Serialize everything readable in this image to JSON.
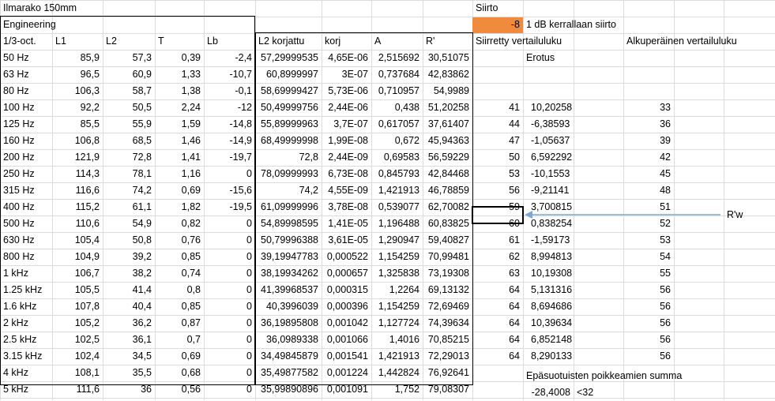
{
  "app": "Spreadsheet",
  "title_cell": "Ilmarako 150mm",
  "engineering_label": "Engineering",
  "headers": [
    "1/3-oct.",
    "L1",
    "L2",
    "T",
    "Lb",
    "L2 korjattu",
    "korj",
    "A",
    "R'"
  ],
  "right_headers": {
    "siirto_label": "Siirto",
    "siirto_value": "-8",
    "siirto_note": "1 dB kerrallaan siirto",
    "shifted_ref": "Siirretty vertailuluku",
    "original_ref": "Alkuperäinen vertailuluku",
    "difference": "Erotus",
    "rw_label": "R'w",
    "sum_label": "Epäsuotuisten poikkeamien summa",
    "sum_value": "-28,4008",
    "sum_limit": "<32"
  },
  "rows": [
    {
      "f": "50 Hz",
      "l1": "85,9",
      "l2": "57,3",
      "t": "0,39",
      "lb": "-2,4",
      "l2k": "57,29999535",
      "korj": "4,65E-06",
      "a": "2,515692",
      "r": "30,51075",
      "s": "",
      "e": "",
      "o": ""
    },
    {
      "f": "63 Hz",
      "l1": "96,5",
      "l2": "60,9",
      "t": "1,33",
      "lb": "-10,7",
      "l2k": "60,8999997",
      "korj": "3E-07",
      "a": "0,737684",
      "r": "42,83862",
      "s": "",
      "e": "",
      "o": ""
    },
    {
      "f": "80 Hz",
      "l1": "106,3",
      "l2": "58,7",
      "t": "1,38",
      "lb": "-0,1",
      "l2k": "58,69999427",
      "korj": "5,73E-06",
      "a": "0,710957",
      "r": "54,9989",
      "s": "",
      "e": "",
      "o": ""
    },
    {
      "f": "100 Hz",
      "l1": "92,2",
      "l2": "50,5",
      "t": "2,24",
      "lb": "-12",
      "l2k": "50,49999756",
      "korj": "2,44E-06",
      "a": "0,438",
      "r": "51,20258",
      "s": "41",
      "e": "10,20258",
      "o": "33"
    },
    {
      "f": "125 Hz",
      "l1": "85,5",
      "l2": "55,9",
      "t": "1,59",
      "lb": "-14,8",
      "l2k": "55,89999963",
      "korj": "3,7E-07",
      "a": "0,617057",
      "r": "37,61407",
      "s": "44",
      "e": "-6,38593",
      "o": "36"
    },
    {
      "f": "160 Hz",
      "l1": "106,8",
      "l2": "68,5",
      "t": "1,46",
      "lb": "-14,9",
      "l2k": "68,49999998",
      "korj": "1,99E-08",
      "a": "0,672",
      "r": "45,94363",
      "s": "47",
      "e": "-1,05637",
      "o": "39"
    },
    {
      "f": "200 Hz",
      "l1": "121,9",
      "l2": "72,8",
      "t": "1,41",
      "lb": "-19,7",
      "l2k": "72,8",
      "korj": "2,44E-09",
      "a": "0,69583",
      "r": "56,59229",
      "s": "50",
      "e": "6,592292",
      "o": "42"
    },
    {
      "f": "250 Hz",
      "l1": "114,3",
      "l2": "78,1",
      "t": "1,16",
      "lb": "0",
      "l2k": "78,09999993",
      "korj": "6,73E-08",
      "a": "0,845793",
      "r": "42,84468",
      "s": "53",
      "e": "-10,1553",
      "o": "45"
    },
    {
      "f": "315 Hz",
      "l1": "116,6",
      "l2": "74,2",
      "t": "0,69",
      "lb": "-15,6",
      "l2k": "74,2",
      "korj": "4,55E-09",
      "a": "1,421913",
      "r": "46,78859",
      "s": "56",
      "e": "-9,21141",
      "o": "48"
    },
    {
      "f": "400 Hz",
      "l1": "115,2",
      "l2": "61,1",
      "t": "1,82",
      "lb": "-19,5",
      "l2k": "61,09999996",
      "korj": "3,78E-08",
      "a": "0,539077",
      "r": "62,70082",
      "s": "59",
      "e": "3,700815",
      "o": "51"
    },
    {
      "f": "500 Hz",
      "l1": "110,6",
      "l2": "54,9",
      "t": "0,82",
      "lb": "0",
      "l2k": "54,89998595",
      "korj": "1,41E-05",
      "a": "1,196488",
      "r": "60,83825",
      "s": "60",
      "e": "0,838254",
      "o": "52"
    },
    {
      "f": "630 Hz",
      "l1": "105,4",
      "l2": "50,8",
      "t": "0,76",
      "lb": "0",
      "l2k": "50,79996388",
      "korj": "3,61E-05",
      "a": "1,290947",
      "r": "59,40827",
      "s": "61",
      "e": "-1,59173",
      "o": "53"
    },
    {
      "f": "800 Hz",
      "l1": "104,9",
      "l2": "39,2",
      "t": "0,85",
      "lb": "0",
      "l2k": "39,19947783",
      "korj": "0,000522",
      "a": "1,154259",
      "r": "70,99481",
      "s": "62",
      "e": "8,994813",
      "o": "54"
    },
    {
      "f": "1 kHz",
      "l1": "106,7",
      "l2": "38,2",
      "t": "0,74",
      "lb": "0",
      "l2k": "38,19934262",
      "korj": "0,000657",
      "a": "1,325838",
      "r": "73,19308",
      "s": "63",
      "e": "10,19308",
      "o": "55"
    },
    {
      "f": "1.25 kHz",
      "l1": "105,5",
      "l2": "41,4",
      "t": "0,8",
      "lb": "0",
      "l2k": "41,39968537",
      "korj": "0,000315",
      "a": "1,2264",
      "r": "69,13132",
      "s": "64",
      "e": "5,131316",
      "o": "56"
    },
    {
      "f": "1.6 kHz",
      "l1": "107,8",
      "l2": "40,4",
      "t": "0,85",
      "lb": "0",
      "l2k": "40,3996039",
      "korj": "0,000396",
      "a": "1,154259",
      "r": "72,69469",
      "s": "64",
      "e": "8,694686",
      "o": "56"
    },
    {
      "f": "2 kHz",
      "l1": "105,2",
      "l2": "36,2",
      "t": "0,87",
      "lb": "0",
      "l2k": "36,19895808",
      "korj": "0,001042",
      "a": "1,127724",
      "r": "74,39634",
      "s": "64",
      "e": "10,39634",
      "o": "56"
    },
    {
      "f": "2.5 kHz",
      "l1": "102,5",
      "l2": "36,1",
      "t": "0,7",
      "lb": "0",
      "l2k": "36,0989338",
      "korj": "0,001066",
      "a": "1,4016",
      "r": "70,85215",
      "s": "64",
      "e": "6,852148",
      "o": "56"
    },
    {
      "f": "3.15 kHz",
      "l1": "102,4",
      "l2": "34,5",
      "t": "0,69",
      "lb": "0",
      "l2k": "34,49845879",
      "korj": "0,001541",
      "a": "1,421913",
      "r": "72,29013",
      "s": "64",
      "e": "8,290133",
      "o": "56"
    },
    {
      "f": "4 kHz",
      "l1": "108,1",
      "l2": "35,5",
      "t": "0,68",
      "lb": "0",
      "l2k": "35,49877582",
      "korj": "0,001224",
      "a": "1,442824",
      "r": "76,92641",
      "s": "",
      "e": "",
      "o": ""
    },
    {
      "f": "5 kHz",
      "l1": "111,6",
      "l2": "36",
      "t": "0,56",
      "lb": "0",
      "l2k": "35,99890896",
      "korj": "0,001091",
      "a": "1,752",
      "r": "79,08307",
      "s": "",
      "e": "",
      "o": ""
    }
  ],
  "colors": {
    "grid": "#dadcdf",
    "accent": "#f08a3c",
    "arrow": "#7fa7cf"
  }
}
